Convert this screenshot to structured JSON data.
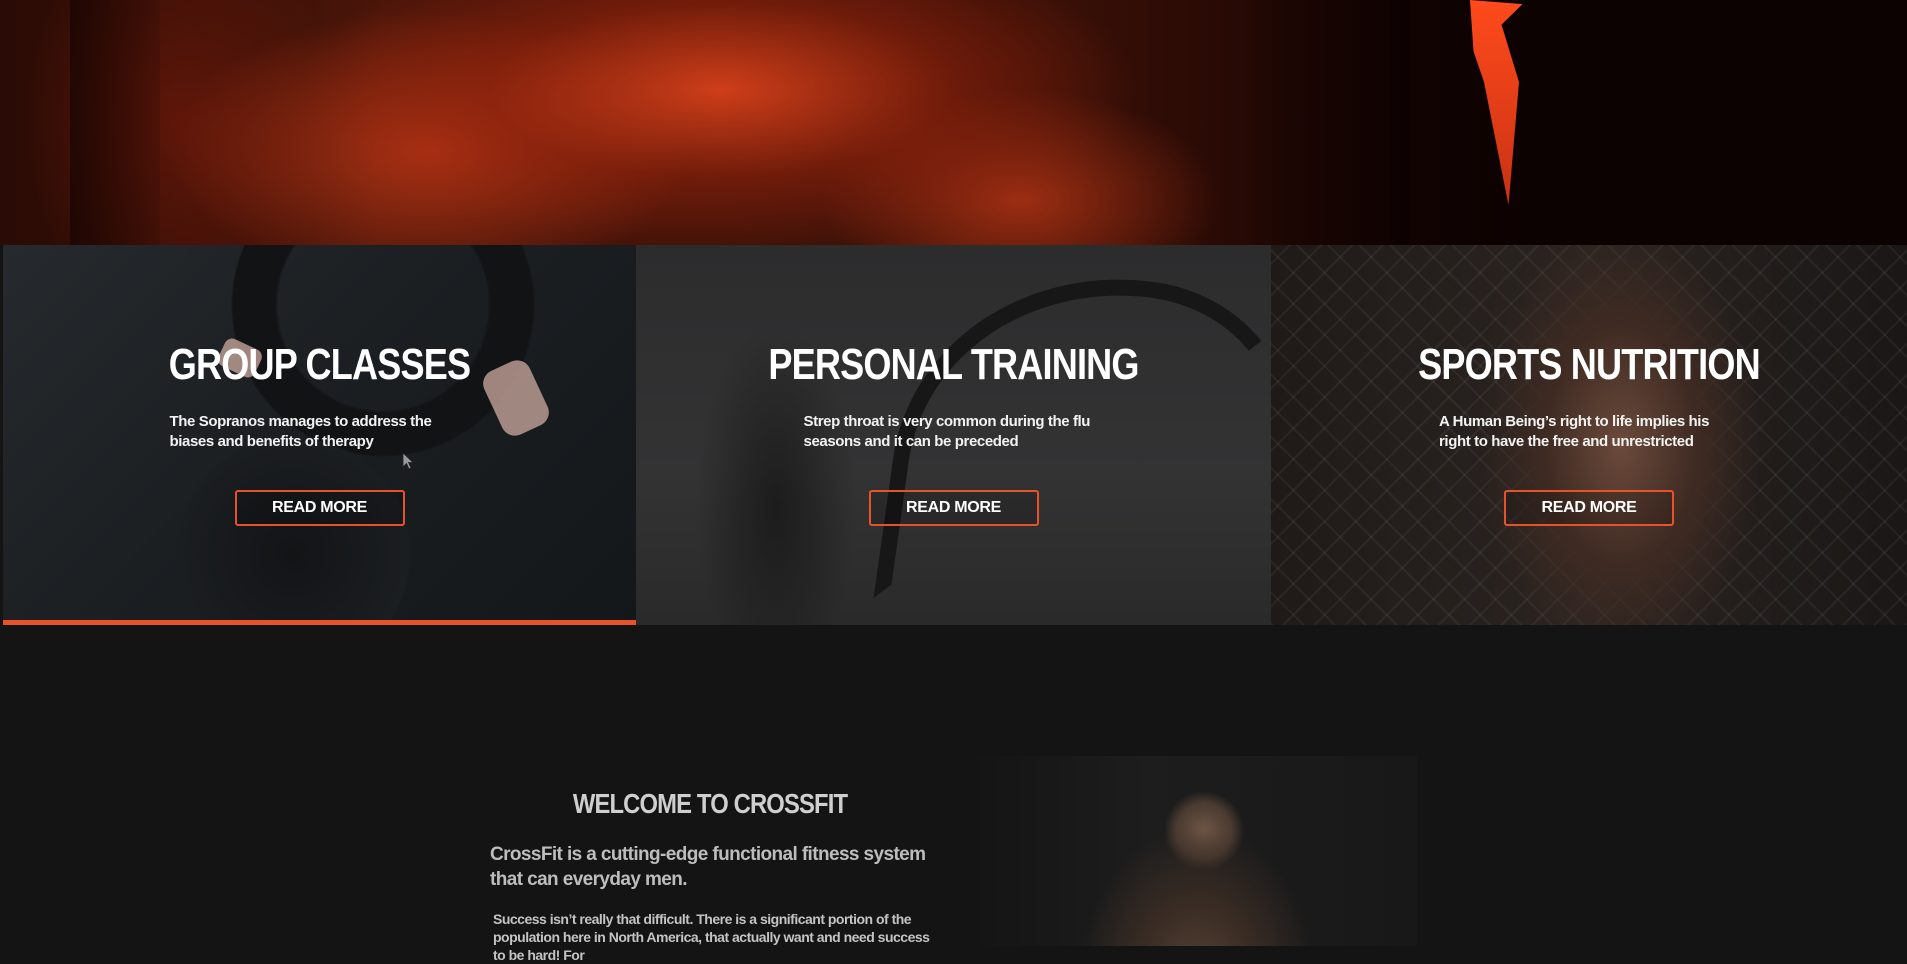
{
  "services": [
    {
      "title": "GROUP CLASSES",
      "text": "The Sopranos manages to address the biases and benefits of therapy",
      "button": "READ MORE"
    },
    {
      "title": "PERSONAL TRAINING",
      "text": "Strep throat is very common during the flu seasons and it can be preceded",
      "button": "READ MORE"
    },
    {
      "title": "SPORTS NUTRITION",
      "text": "A Human Being’s right to life implies his right to have the free and unrestricted",
      "button": "READ MORE"
    }
  ],
  "welcome": {
    "title": "WELCOME TO CROSSFIT",
    "lead": "CrossFit is a cutting-edge functional fitness system that can everyday men.",
    "body": "Success isn’t really that difficult. There is a significant portion of the population here in North America, that actually want and need success to be hard! For"
  },
  "colors": {
    "accent": "#e8522a",
    "background": "#141414"
  }
}
